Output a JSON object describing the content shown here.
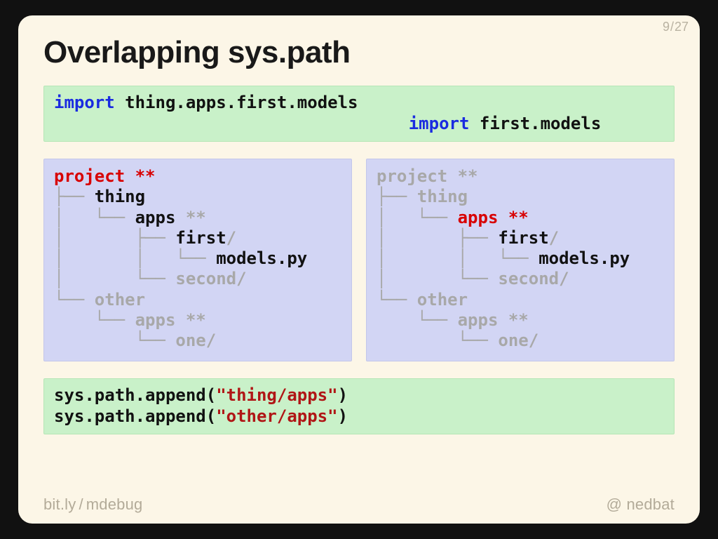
{
  "page": {
    "current": "9",
    "total": "27"
  },
  "title": "Overlapping sys.path",
  "imports": {
    "line1_kw": "import",
    "line1_rest": " thing.apps.first.models",
    "line2_pad": "                                   ",
    "line2_kw": "import",
    "line2_rest": " first.models"
  },
  "tree_left": {
    "l1": "project ",
    "l1_mark": "**",
    "l2_branch": "├── ",
    "l2_text": "thing",
    "l3_branch": "│   └── ",
    "l3_text": "apps ",
    "l3_mark": "**",
    "l4_branch": "│       ├── ",
    "l4_text": "first",
    "l4_slash": "/",
    "l5_branch": "│       │   └── ",
    "l5_text": "models.py",
    "l6_branch": "│       └── ",
    "l6_text": "second",
    "l6_slash": "/",
    "l7_branch": "└── ",
    "l7_text": "other",
    "l8_branch": "    └── ",
    "l8_text": "apps ",
    "l8_mark": "**",
    "l9_branch": "        └── ",
    "l9_text": "one",
    "l9_slash": "/"
  },
  "tree_right": {
    "l1": "project ",
    "l1_mark": "**",
    "l2_branch": "├── ",
    "l2_text": "thing",
    "l3_branch": "│   └── ",
    "l3_text": "apps ",
    "l3_mark": "**",
    "l4_branch": "│       ├── ",
    "l4_text": "first",
    "l4_slash": "/",
    "l5_branch": "│       │   └── ",
    "l5_text": "models.py",
    "l6_branch": "│       └── ",
    "l6_text": "second",
    "l6_slash": "/",
    "l7_branch": "└── ",
    "l7_text": "other",
    "l8_branch": "    └── ",
    "l8_text": "apps ",
    "l8_mark": "**",
    "l9_branch": "        └── ",
    "l9_text": "one",
    "l9_slash": "/"
  },
  "append": {
    "l1_a": "sys.path.append(",
    "l1_str": "\"thing/apps\"",
    "l1_b": ")",
    "l2_a": "sys.path.append(",
    "l2_str": "\"other/apps\"",
    "l2_b": ")"
  },
  "footer": {
    "left_a": "bit.ly",
    "left_sep": "/",
    "left_b": "mdebug",
    "right_at": "@",
    "right_name": "nedbat"
  }
}
